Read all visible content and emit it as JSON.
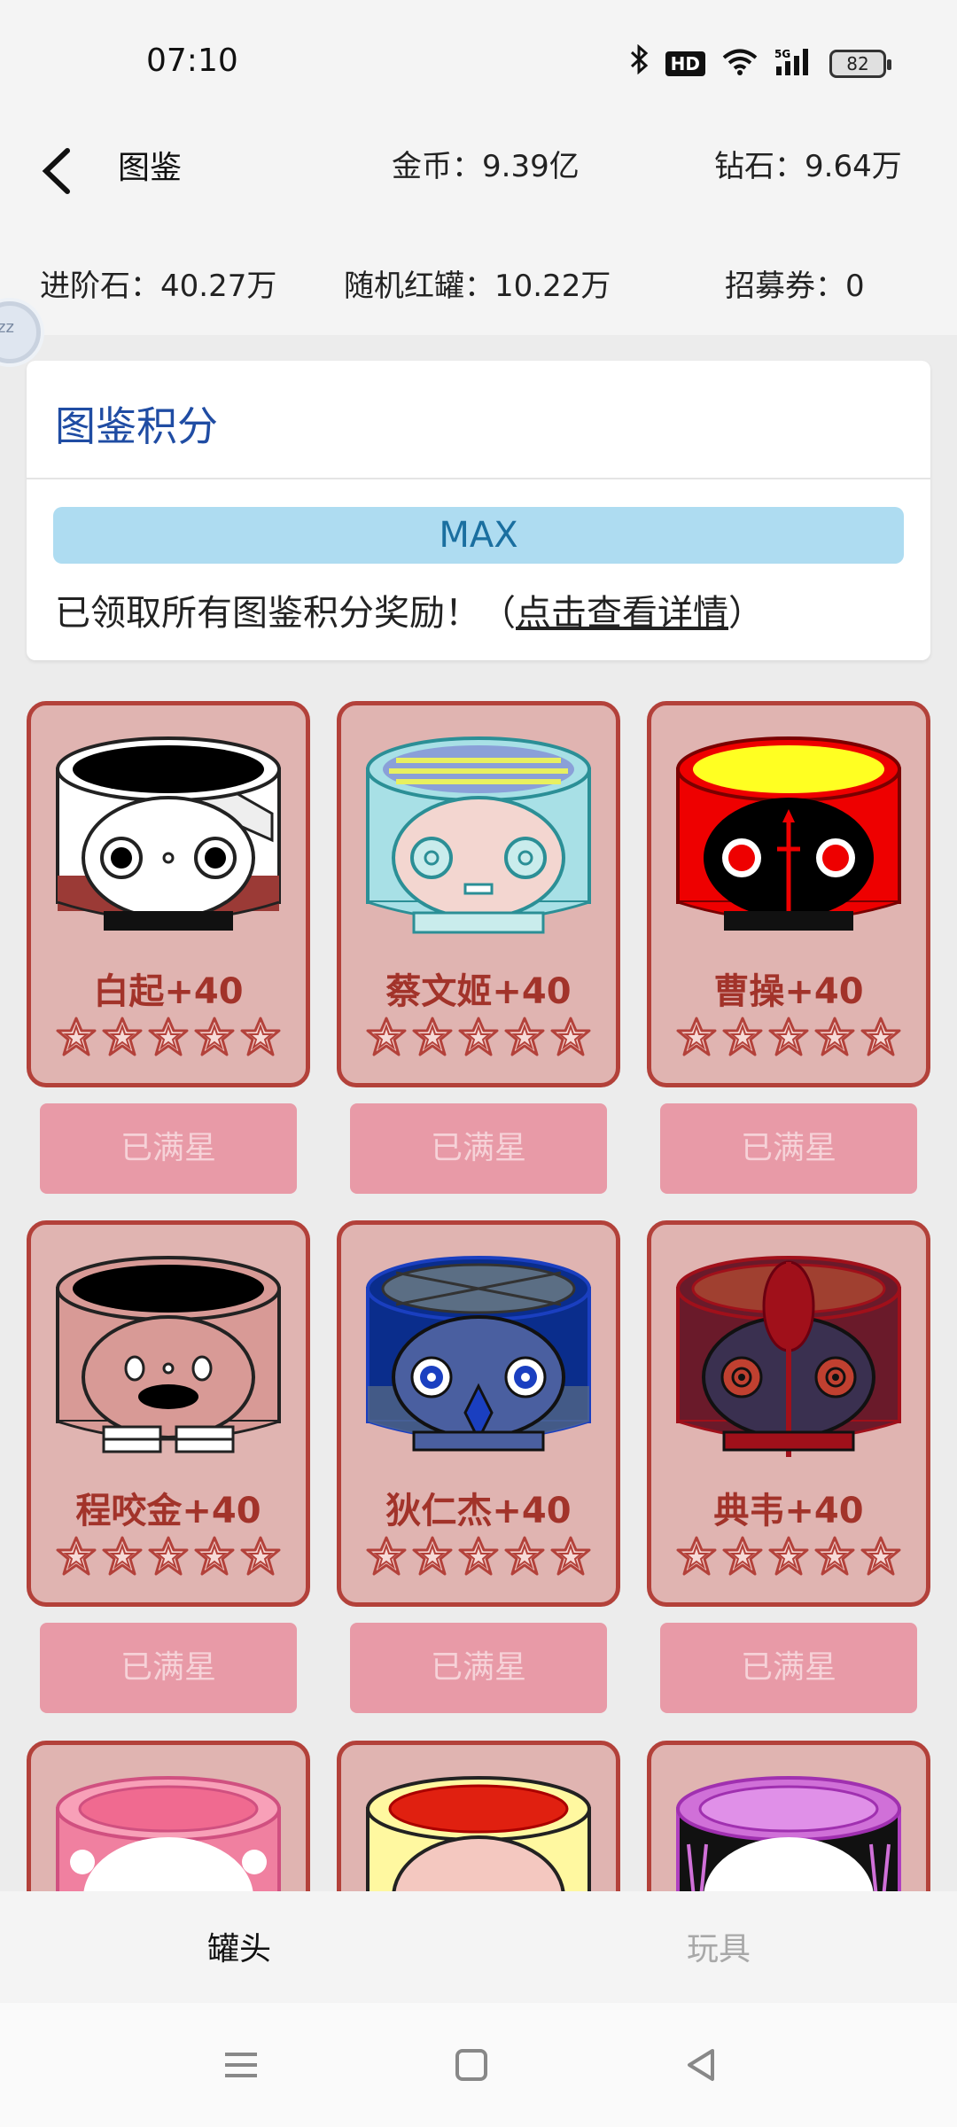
{
  "status": {
    "time": "07:10",
    "hd": "HD",
    "battery": "82"
  },
  "header": {
    "title": "图鉴",
    "coins": "金币：9.39亿",
    "diamonds": "钻石：9.64万",
    "advance_stones": "进阶石：40.27万",
    "random_jars": "随机红罐：10.22万",
    "recruit_tickets": "招募券：0"
  },
  "score": {
    "title": "图鉴积分",
    "progress_label": "MAX",
    "progress": 1.0,
    "message": "已领取所有图鉴积分奖励！（",
    "link": "点击查看详情",
    "message_end": "）"
  },
  "cards": [
    {
      "name": "白起+40",
      "stars": 5,
      "button": "已满星"
    },
    {
      "name": "蔡文姬+40",
      "stars": 5,
      "button": "已满星"
    },
    {
      "name": "曹操+40",
      "stars": 5,
      "button": "已满星"
    },
    {
      "name": "程咬金+40",
      "stars": 5,
      "button": "已满星"
    },
    {
      "name": "狄仁杰+40",
      "stars": 5,
      "button": "已满星"
    },
    {
      "name": "典韦+40",
      "stars": 5,
      "button": "已满星"
    }
  ],
  "tabs": {
    "jars": "罐头",
    "toys": "玩具"
  },
  "colors": {
    "accent": "#1f4ca3",
    "card_border": "#b3413a",
    "card_bg": "#e0b4b1",
    "button_bg": "#e89aa7"
  }
}
